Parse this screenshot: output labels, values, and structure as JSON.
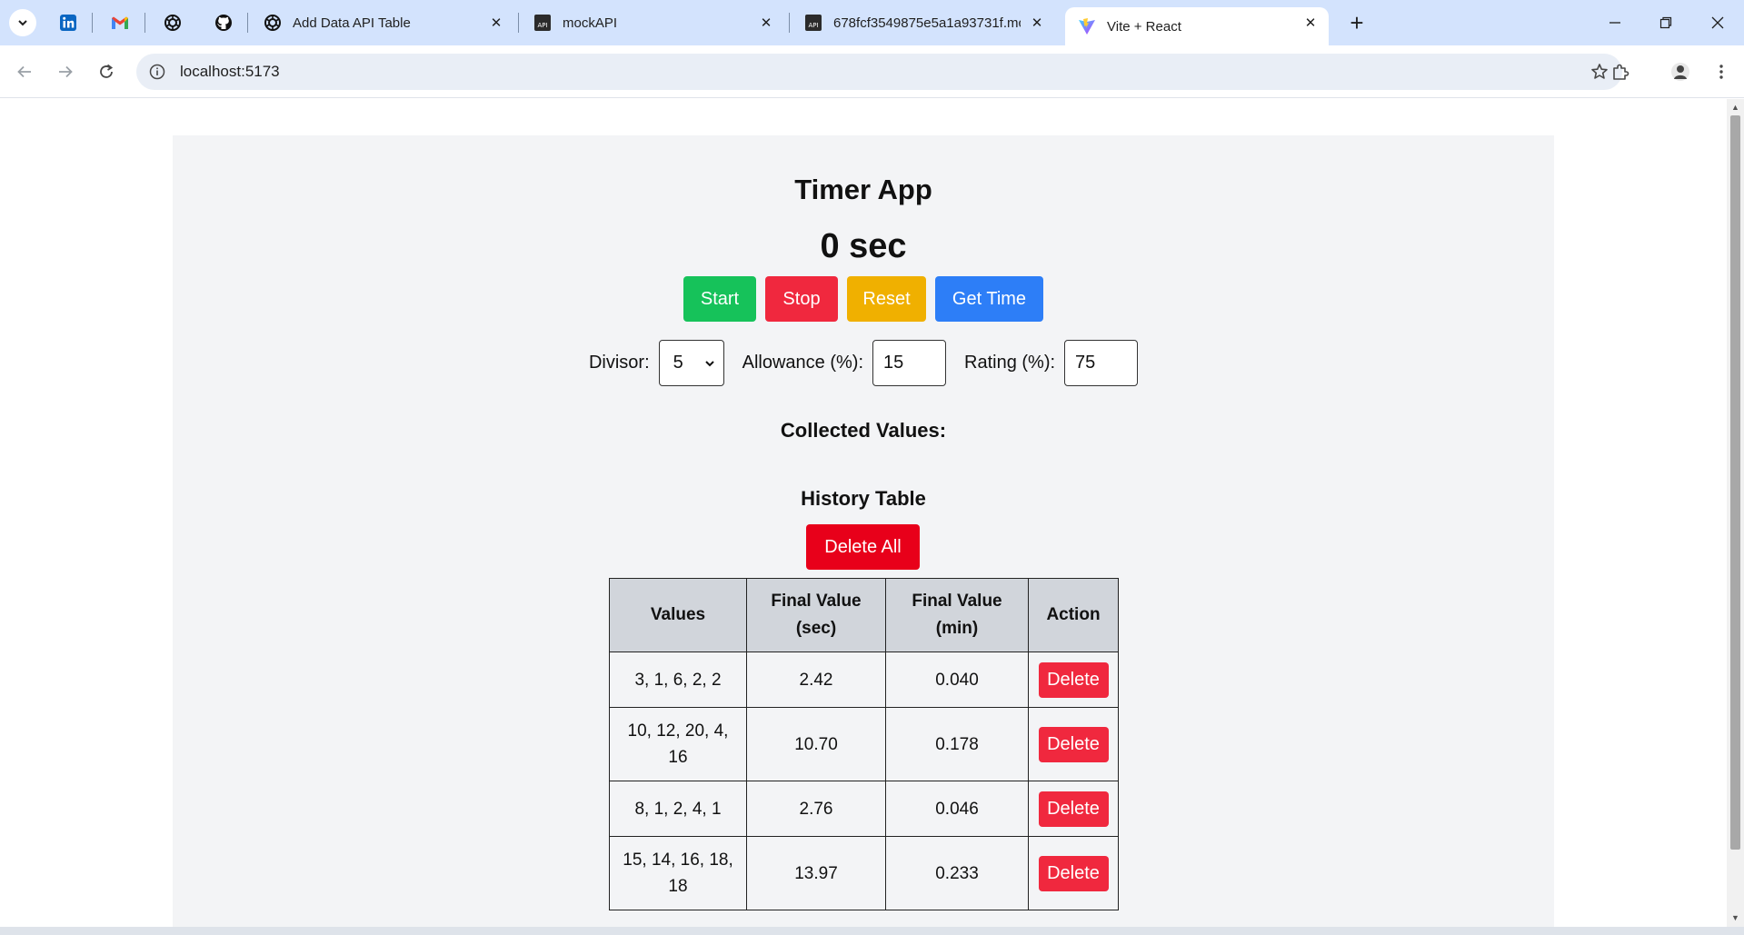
{
  "browser": {
    "tabs": [
      {
        "title": "Add Data API Table",
        "icon": "openai-icon"
      },
      {
        "title": "mockAPI",
        "icon": "mockapi-icon"
      },
      {
        "title": "678fcf3549875e5a1a93731f.mc",
        "icon": "mockapi-icon"
      },
      {
        "title": "Vite + React",
        "icon": "vite-icon",
        "active": true
      }
    ],
    "pinned": [
      "linkedin-icon",
      "gmail-icon",
      "openai-icon",
      "github-icon"
    ],
    "url": "localhost:5173"
  },
  "app": {
    "title": "Timer App",
    "timer_display": "0 sec",
    "buttons": {
      "start": "Start",
      "stop": "Stop",
      "reset": "Reset",
      "get_time": "Get Time"
    },
    "divisor": {
      "label": "Divisor:",
      "value": "5"
    },
    "allowance": {
      "label": "Allowance (%):",
      "value": "15"
    },
    "rating": {
      "label": "Rating (%):",
      "value": "75"
    },
    "collected_heading": "Collected Values:",
    "history_heading": "History Table",
    "delete_all_label": "Delete All",
    "table": {
      "headers": {
        "values": "Values",
        "final_sec_line1": "Final Value",
        "final_sec_line2": "(sec)",
        "final_min_line1": "Final Value",
        "final_min_line2": "(min)",
        "action": "Action"
      },
      "rows": [
        {
          "values": "3, 1, 6, 2, 2",
          "final_sec": "2.42",
          "final_min": "0.040",
          "action": "Delete"
        },
        {
          "values": "10, 12, 20, 4, 16",
          "final_sec": "10.70",
          "final_min": "0.178",
          "action": "Delete"
        },
        {
          "values": "8, 1, 2, 4, 1",
          "final_sec": "2.76",
          "final_min": "0.046",
          "action": "Delete"
        },
        {
          "values": "15, 14, 16, 18, 18",
          "final_sec": "13.97",
          "final_min": "0.233",
          "action": "Delete"
        }
      ]
    }
  }
}
